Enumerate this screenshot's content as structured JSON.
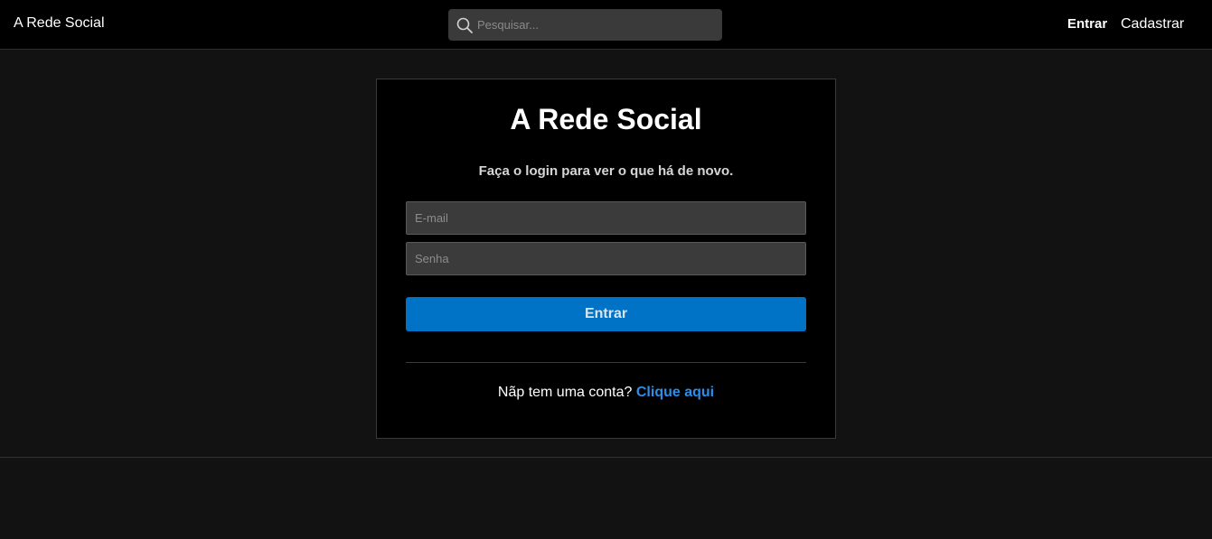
{
  "header": {
    "brand": "A Rede Social",
    "search_placeholder": "Pesquisar...",
    "login_label": "Entrar",
    "signup_label": "Cadastrar"
  },
  "login_card": {
    "title": "A Rede Social",
    "subtitle": "Faça o login para ver o que há de novo.",
    "email_placeholder": "E-mail",
    "password_placeholder": "Senha",
    "submit_label": "Entrar",
    "signup_prompt": "Nãp tem uma conta?",
    "signup_link": "Clique aqui"
  },
  "colors": {
    "accent": "#0073c6",
    "link": "#2b8ee8",
    "background": "#121212",
    "card": "#000000"
  },
  "icons": {
    "search": "search-icon"
  }
}
